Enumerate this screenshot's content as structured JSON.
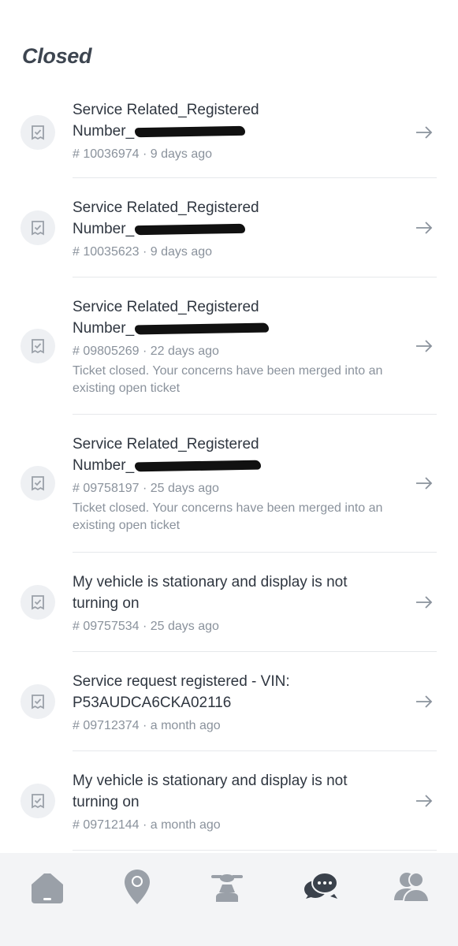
{
  "section": {
    "title": "Closed"
  },
  "tickets": [
    {
      "title_line1": "Service Related_Registered",
      "title_line2": "Number_",
      "redacted": true,
      "id": "# 10036974",
      "age": "9 days ago",
      "note": ""
    },
    {
      "title_line1": "Service Related_Registered",
      "title_line2": "Number_",
      "redacted": true,
      "id": "# 10035623",
      "age": "9 days ago",
      "note": ""
    },
    {
      "title_line1": "Service Related_Registered",
      "title_line2": "Number_",
      "redacted": true,
      "id": "# 09805269",
      "age": "22 days ago",
      "note": "Ticket closed. Your concerns have been merged into an existing open ticket"
    },
    {
      "title_line1": "Service Related_Registered",
      "title_line2": "Number_",
      "redacted": true,
      "id": "# 09758197",
      "age": "25 days ago",
      "note": "Ticket closed. Your concerns have been merged into an existing open ticket"
    },
    {
      "title_line1": "My vehicle is stationary and display is not",
      "title_line2": "turning on",
      "redacted": false,
      "id": "# 09757534",
      "age": "25 days ago",
      "note": ""
    },
    {
      "title_line1": "Service request registered - VIN:",
      "title_line2": "P53AUDCA6CKA02116",
      "redacted": false,
      "id": "# 09712374",
      "age": "a month ago",
      "note": ""
    },
    {
      "title_line1": "My vehicle is stationary and display is not",
      "title_line2": "turning on",
      "redacted": false,
      "id": "# 09712144",
      "age": "a month ago",
      "note": ""
    }
  ],
  "nav": {
    "items": [
      {
        "icon": "home-icon"
      },
      {
        "icon": "location-pin-icon"
      },
      {
        "icon": "scooter-icon"
      },
      {
        "icon": "chat-support-icon",
        "active": true
      },
      {
        "icon": "profile-icon"
      }
    ]
  },
  "colors": {
    "active_nav": "#3a414b",
    "inactive_nav": "#9aa0a8",
    "meta_text": "#8a929c"
  }
}
